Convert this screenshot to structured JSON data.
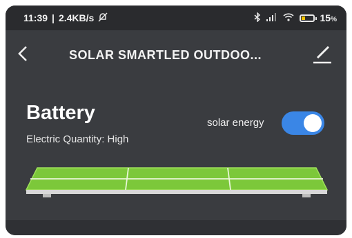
{
  "status_bar": {
    "time": "11:39",
    "speed": "2.4KB/s",
    "battery_percent": "15",
    "battery_unit": "%",
    "icons": [
      "alarm-off-icon",
      "bluetooth-icon",
      "signal-icon",
      "wifi-icon",
      "battery-icon"
    ]
  },
  "header": {
    "back_icon": "back-chevron-icon",
    "title": "SOLAR SMARTLED OUTDOO...",
    "edit_icon": "edit-pencil-icon"
  },
  "battery": {
    "heading": "Battery",
    "status": "Electric Quantity: High",
    "level": 1.0
  },
  "solar_toggle": {
    "label": "solar energy",
    "on": true
  },
  "colors": {
    "accent": "#3a86e6",
    "panel_green": "#7cc83a",
    "background": "#3a3c40",
    "status_bar": "#2a2b2e"
  }
}
